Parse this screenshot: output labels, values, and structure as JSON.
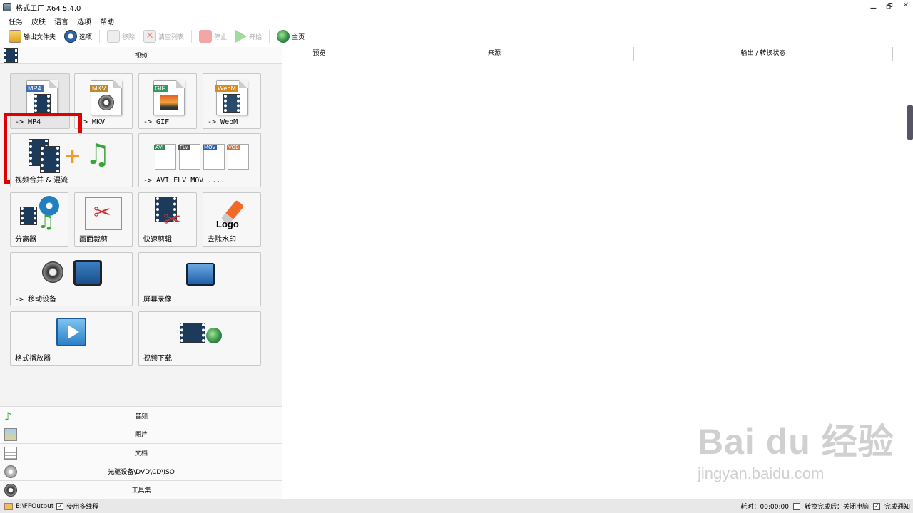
{
  "window": {
    "title": "格式工厂 X64 5.4.0",
    "min": "▁",
    "max": "🗗",
    "close": "✕"
  },
  "menu": [
    "任务",
    "皮肤",
    "语言",
    "选项",
    "帮助"
  ],
  "toolbar": {
    "output_folder": "输出文件夹",
    "options": "选项",
    "remove": "移除",
    "clear_list": "清空列表",
    "stop": "停止",
    "start": "开始",
    "home": "主页"
  },
  "video_section": {
    "label": "视频"
  },
  "tiles": {
    "mp4": {
      "tag": "MP4",
      "label": "-> MP4",
      "tag_color": "#3a6fb5"
    },
    "mkv": {
      "tag": "MKV",
      "label": "-> MKV",
      "tag_color": "#5a5a5a"
    },
    "gif": {
      "tag": "GIF",
      "label": "-> GIF",
      "tag_color": "#2e9c5a"
    },
    "webm": {
      "tag": "WebM",
      "label": "-> WebM",
      "tag_color": "#d88a20"
    },
    "merge": {
      "label": "视频合并 & 混流"
    },
    "avi": {
      "label": "-> AVI FLV MOV ....",
      "tags": [
        "AVI",
        "FLV",
        "MOV",
        "VOB"
      ]
    },
    "splitter": {
      "label": "分离器"
    },
    "crop": {
      "label": "画面裁剪"
    },
    "quickcut": {
      "label": "快速剪辑"
    },
    "watermark": {
      "label": "去除水印",
      "logo_text": "Logo"
    },
    "mobile": {
      "label": "-> 移动设备"
    },
    "screen": {
      "label": "屏幕录像"
    },
    "player": {
      "label": "格式播放器"
    },
    "download": {
      "label": "视频下载"
    }
  },
  "sections": [
    "音频",
    "图片",
    "文档",
    "光驱设备\\DVD\\CD\\ISO",
    "工具集"
  ],
  "table": {
    "headers": [
      "预览",
      "来源",
      "输出 / 转换状态"
    ]
  },
  "watermark": {
    "brand": "Bai du 经验",
    "url": "jingyan.baidu.com"
  },
  "status": {
    "output_path": "E:\\FFOutput",
    "multithread": "使用多线程",
    "elapsed": "耗时：00:00:00",
    "after_convert": "转换完成后：关闭电脑",
    "notify": "完成通知"
  },
  "colors": {
    "highlight": "#e00000"
  }
}
